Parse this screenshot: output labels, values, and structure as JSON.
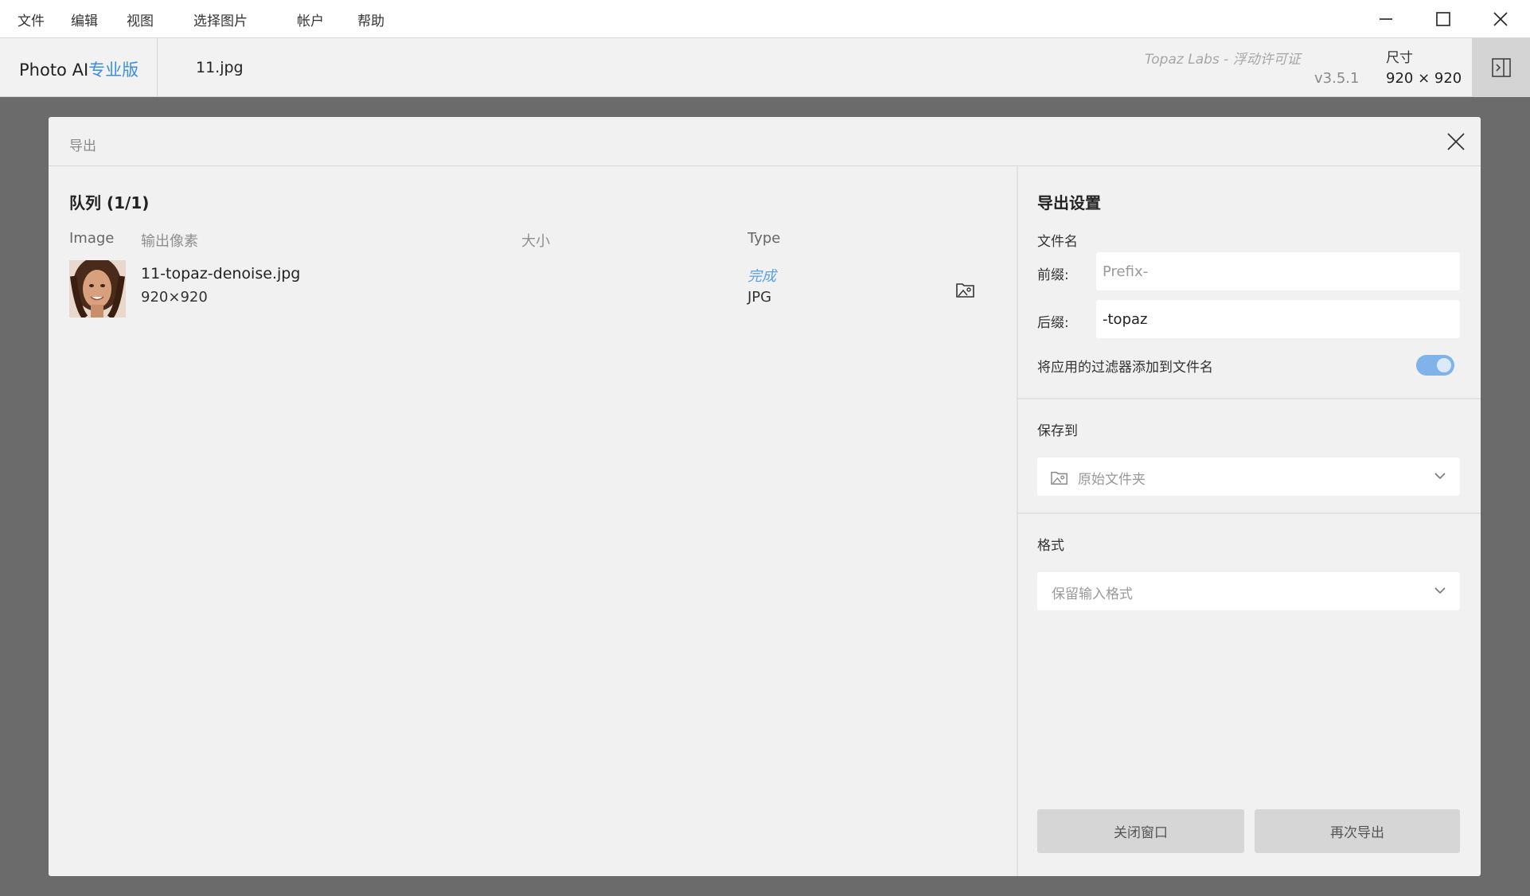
{
  "menu": {
    "items": [
      "文件",
      "编辑",
      "视图",
      "选择图片",
      "帐户",
      "帮助"
    ]
  },
  "window_controls": {
    "icons": [
      "minimize-icon",
      "maximize-icon",
      "close-icon"
    ]
  },
  "titlebar": {
    "app_name": "Photo AI",
    "app_edition": "专业版",
    "file_name": "11.jpg",
    "license": "Topaz Labs - 浮动许可证",
    "version": "v3.5.1",
    "size_label": "尺寸",
    "size_value": "920 × 920"
  },
  "dialog": {
    "title": "导出",
    "queue": {
      "title": "队列  (1/1)",
      "columns": [
        "Image",
        "输出像素",
        "大小",
        "Type"
      ],
      "rows": [
        {
          "name": "11-topaz-denoise.jpg",
          "dims": "920×920",
          "size": "",
          "status": "完成",
          "type": "JPG"
        }
      ]
    },
    "settings": {
      "title": "导出设置",
      "filename_label": "文件名",
      "prefix_label": "前缀:",
      "prefix_placeholder": "Prefix-",
      "suffix_label": "后缀:",
      "suffix_value": "-topaz",
      "append_filters_label": "将应用的过滤器添加到文件名",
      "append_filters_on": true,
      "save_to_label": "保存到",
      "save_to_value": "原始文件夹",
      "format_label": "格式",
      "format_value": "保留输入格式"
    },
    "buttons": {
      "close": "关闭窗口",
      "export_again": "再次导出"
    }
  },
  "colors": {
    "accent": "#3a8ee6",
    "toggle_on": "#7fb3ea",
    "status_done": "#5aa0e8"
  }
}
